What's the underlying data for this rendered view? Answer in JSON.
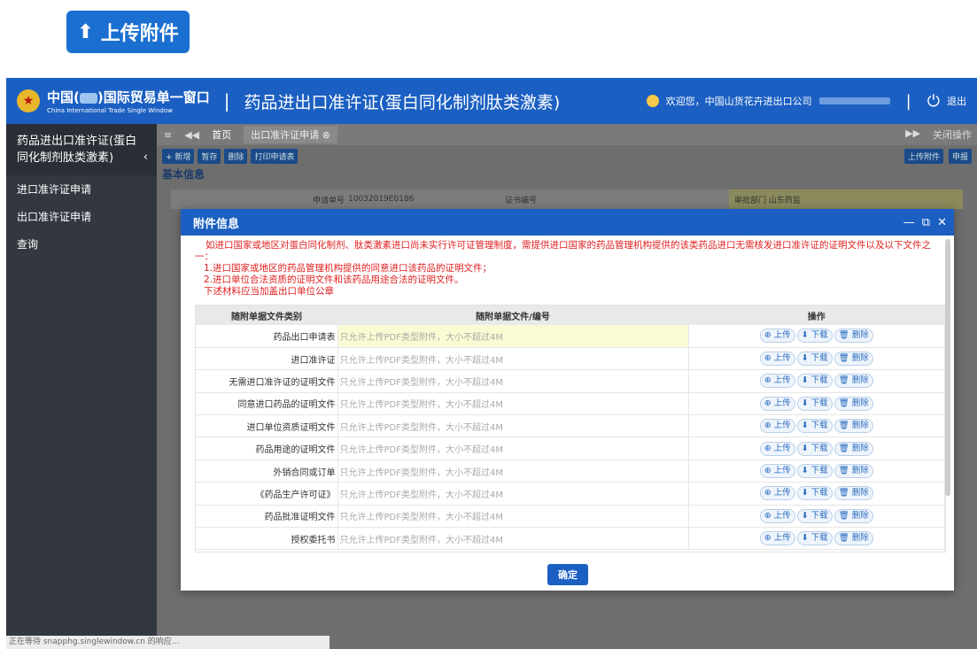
{
  "top_button": {
    "icon": "upload-icon",
    "label": "上传附件"
  },
  "header": {
    "brand_cn_pre": "中国(",
    "brand_cn_post": ")国际贸易单一窗口",
    "brand_en": "China International Trade Single Window",
    "separator": "|",
    "app_title": "药品进出口准许证(蛋白同化制剂肽类激素)",
    "welcome": "欢迎您，中国山货花卉进出口公司",
    "logout": "退出"
  },
  "sidebar": {
    "title": "药品进出口准许证(蛋白同化制剂肽类激素)",
    "items": [
      "进口准许证申请",
      "出口准许证申请",
      "查询"
    ]
  },
  "tabs": {
    "home": "首页",
    "current": "出口准许证申请",
    "close_ops": "关闭操作"
  },
  "toolbar": {
    "new": "+ 新增",
    "save": "暂存",
    "delete": "删除",
    "print": "打印申请表",
    "upload": "上传附件",
    "submit": "申报"
  },
  "section": {
    "basic_info": "基本信息"
  },
  "bg_form": {
    "apply_no_label": "申请单号",
    "apply_no": "10032019E0186",
    "cert_no_label": "证书编号",
    "dept_label": "审批部门",
    "dept": "山东药监"
  },
  "modal": {
    "title": "附件信息",
    "notice": {
      "line1": "如进口国家或地区对蛋白同化制剂、肽类激素进口尚未实行许可证管理制度，需提供进口国家的药品管理机构提供的该类药品进口无需核发进口准许证的证明文件以及以下文件之一：",
      "line2": "1.进口国家或地区的药品管理机构提供的同意进口该药品的证明文件；",
      "line3": "2.进口单位合法资质的证明文件和该药品用途合法的证明文件。",
      "line4": "下述材料应当加盖出口单位公章"
    },
    "columns": [
      "随附单据文件类别",
      "随附单据文件/编号",
      "操作"
    ],
    "placeholder": "只允许上传PDF类型附件，大小不超过4M",
    "op_upload": "上传",
    "op_download": "下载",
    "op_delete": "删除",
    "rows": [
      "药品出口申请表",
      "进口准许证",
      "无需进口准许证的证明文件",
      "同意进口药品的证明文件",
      "进口单位资质证明文件",
      "药品用途的证明文件",
      "外销合同或订单",
      "《药品生产许可证》",
      "药品批准证明文件",
      "授权委托书"
    ],
    "confirm": "确定"
  },
  "status_bar": "正在等待 snapphg.singlewindow.cn 的响应..."
}
